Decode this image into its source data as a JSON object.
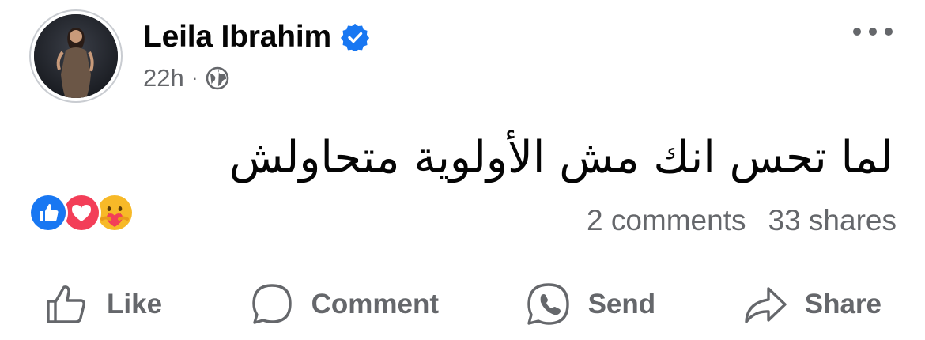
{
  "post": {
    "author_name": "Leila Ibrahim",
    "timestamp": "22h",
    "separator": "·",
    "audience_icon": "globe-icon",
    "text": "لما تحس انك مش الأولوية متحاولش"
  },
  "reactions": {
    "icons": [
      "like-reaction-icon",
      "love-reaction-icon",
      "care-reaction-icon"
    ],
    "comments": "2 comments",
    "shares": "33 shares"
  },
  "actions": {
    "like": "Like",
    "comment": "Comment",
    "send": "Send",
    "share": "Share"
  },
  "colors": {
    "accent": "#1877f2",
    "love": "#f33e58",
    "secondary_text": "#65676b"
  }
}
